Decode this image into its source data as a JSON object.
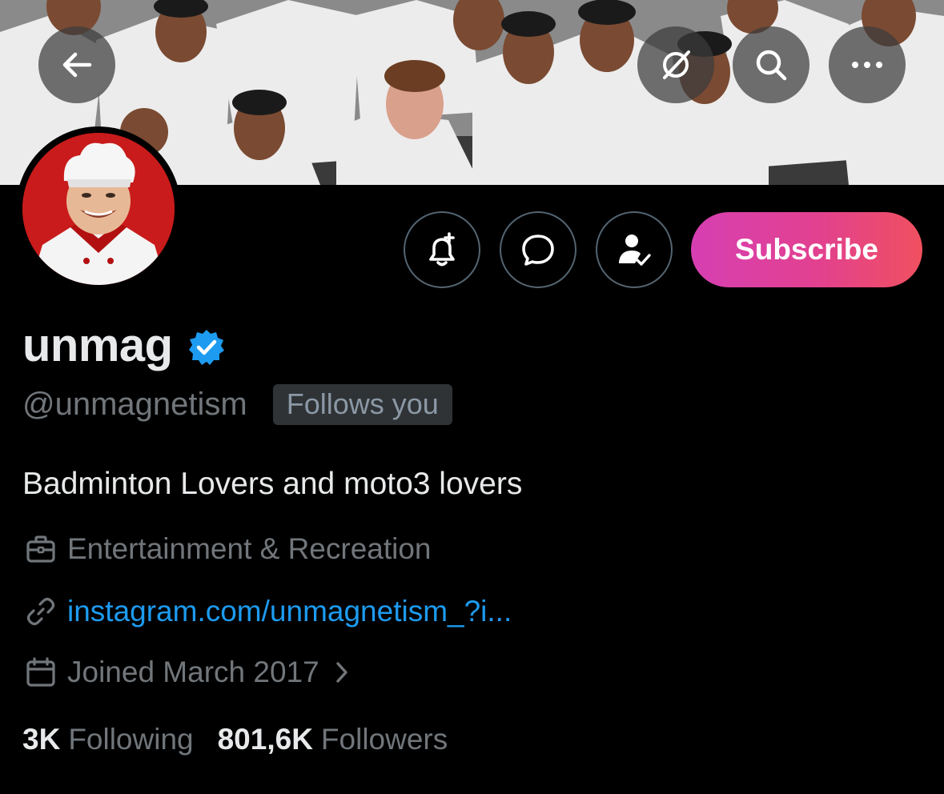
{
  "header": {
    "back_icon": "arrow-left-icon",
    "grok_icon": "grok-icon",
    "search_icon": "search-icon",
    "more_icon": "more-horizontal-icon"
  },
  "banner": {
    "description_icon": "banner-photo"
  },
  "actions": {
    "notify_icon": "bell-plus-icon",
    "message_icon": "message-bubble-icon",
    "follow_icon": "person-check-icon",
    "subscribe_label": "Subscribe"
  },
  "profile": {
    "display_name": "unmag",
    "handle": "@unmagnetism",
    "follows_you": "Follows you",
    "bio": "Badminton Lovers and moto3 lovers",
    "category": "Entertainment & Recreation",
    "link": "instagram.com/unmagnetism_?i...",
    "joined": "Joined March 2017"
  },
  "stats": {
    "following_count": "3K",
    "following_label": "Following",
    "followers_count": "801,6K",
    "followers_label": "Followers"
  },
  "colors": {
    "background": "#000000",
    "text_primary": "#e7e9ea",
    "text_secondary": "#71767b",
    "link": "#1d9bf0",
    "verified": "#1d9bf0",
    "subscribe_gradient_start": "#d63fb2",
    "subscribe_gradient_end": "#f0505f"
  }
}
